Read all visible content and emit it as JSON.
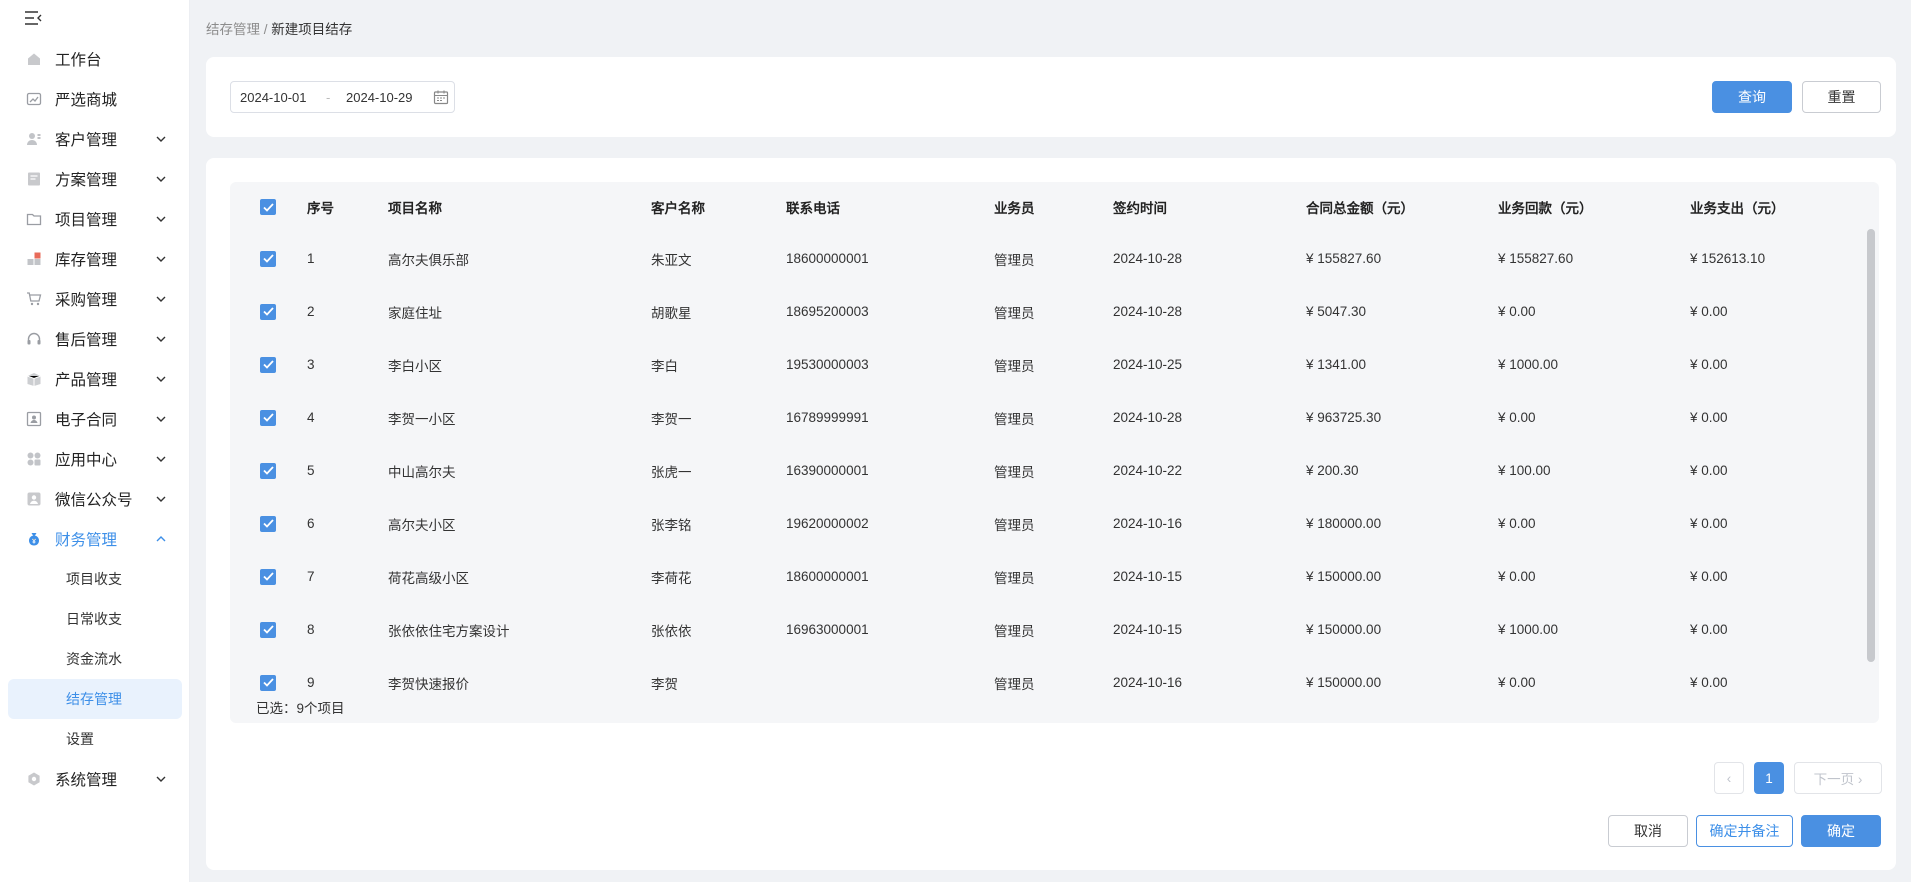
{
  "sidebar": {
    "items": [
      {
        "label": "工作台",
        "icon": "home-icon",
        "has_children": false
      },
      {
        "label": "严选商城",
        "icon": "chart-icon",
        "has_children": false
      },
      {
        "label": "客户管理",
        "icon": "user-icon",
        "has_children": true
      },
      {
        "label": "方案管理",
        "icon": "document-icon",
        "has_children": true
      },
      {
        "label": "项目管理",
        "icon": "folder-icon",
        "has_children": true
      },
      {
        "label": "库存管理",
        "icon": "inventory-icon",
        "has_children": true
      },
      {
        "label": "采购管理",
        "icon": "cart-icon",
        "has_children": true
      },
      {
        "label": "售后管理",
        "icon": "headset-icon",
        "has_children": true
      },
      {
        "label": "产品管理",
        "icon": "box-icon",
        "has_children": true
      },
      {
        "label": "电子合同",
        "icon": "contract-icon",
        "has_children": true
      },
      {
        "label": "应用中心",
        "icon": "apps-icon",
        "has_children": true
      },
      {
        "label": "微信公众号",
        "icon": "wechat-icon",
        "has_children": true
      },
      {
        "label": "财务管理",
        "icon": "money-bag-icon",
        "has_children": true,
        "expanded": true
      },
      {
        "label": "系统管理",
        "icon": "system-icon",
        "has_children": true
      }
    ],
    "finance_sub": [
      "项目收支",
      "日常收支",
      "资金流水",
      "结存管理",
      "设置"
    ],
    "active_sub": "结存管理"
  },
  "breadcrumb": {
    "parent": "结存管理",
    "separator": "/",
    "current": "新建项目结存"
  },
  "filter": {
    "date_start": "2024-10-01",
    "date_separator": "-",
    "date_end": "2024-10-29",
    "query_label": "查询",
    "reset_label": "重置"
  },
  "table": {
    "columns": [
      "序号",
      "项目名称",
      "客户名称",
      "联系电话",
      "业务员",
      "签约时间",
      "合同总金额（元）",
      "业务回款（元）",
      "业务支出（元）"
    ],
    "rows": [
      [
        "1",
        "高尔夫俱乐部",
        "朱亚文",
        "18600000001",
        "管理员",
        "2024-10-28",
        "¥ 155827.60",
        "¥ 155827.60",
        "¥ 152613.10"
      ],
      [
        "2",
        "家庭住址",
        "胡歌星",
        "18695200003",
        "管理员",
        "2024-10-28",
        "¥ 5047.30",
        "¥ 0.00",
        "¥ 0.00"
      ],
      [
        "3",
        "李白小区",
        "李白",
        "19530000003",
        "管理员",
        "2024-10-25",
        "¥ 1341.00",
        "¥ 1000.00",
        "¥ 0.00"
      ],
      [
        "4",
        "李贺一小区",
        "李贺一",
        "16789999991",
        "管理员",
        "2024-10-28",
        "¥ 963725.30",
        "¥ 0.00",
        "¥ 0.00"
      ],
      [
        "5",
        "中山高尔夫",
        "张虎一",
        "16390000001",
        "管理员",
        "2024-10-22",
        "¥ 200.30",
        "¥ 100.00",
        "¥ 0.00"
      ],
      [
        "6",
        "高尔夫小区",
        "张李铭",
        "19620000002",
        "管理员",
        "2024-10-16",
        "¥ 180000.00",
        "¥ 0.00",
        "¥ 0.00"
      ],
      [
        "7",
        "荷花高级小区",
        "李荷花",
        "18600000001",
        "管理员",
        "2024-10-15",
        "¥ 150000.00",
        "¥ 0.00",
        "¥ 0.00"
      ],
      [
        "8",
        "张依依住宅方案设计",
        "张依依",
        "16963000001",
        "管理员",
        "2024-10-15",
        "¥ 150000.00",
        "¥ 1000.00",
        "¥ 0.00"
      ],
      [
        "9",
        "李贺快速报价",
        "李贺",
        "",
        "管理员",
        "2024-10-16",
        "¥ 150000.00",
        "¥ 0.00",
        "¥ 0.00"
      ]
    ],
    "selected_text": "已选：9个项目"
  },
  "pagination": {
    "prev_glyph": "‹",
    "current_page": "1",
    "next_label": "下一页 ›"
  },
  "actions": {
    "cancel_label": "取消",
    "confirm_note_label": "确定并备注",
    "confirm_label": "确定"
  },
  "colors": {
    "primary": "#4a90e2",
    "sidebar_active_bg": "#e9f2fd",
    "page_bg": "#f0f2f5"
  }
}
